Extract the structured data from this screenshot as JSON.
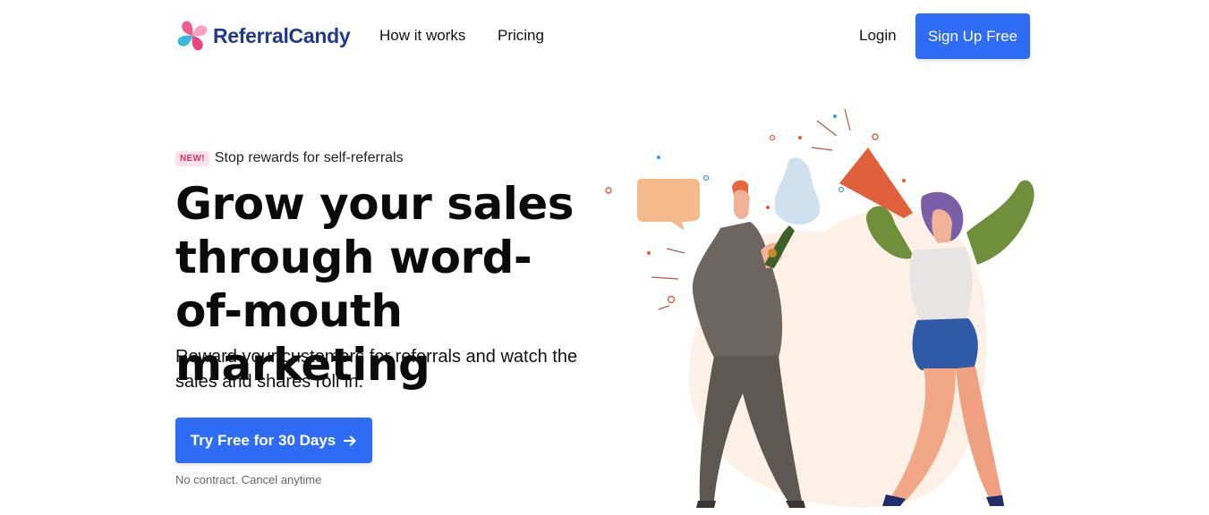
{
  "brand": {
    "name": "ReferralCandy"
  },
  "nav": {
    "links": [
      "How it works",
      "Pricing"
    ],
    "login": "Login",
    "signup": "Sign Up Free"
  },
  "hero": {
    "badge": "NEW!",
    "announcement": "Stop rewards for self-referrals",
    "headline": "Grow your sales through word-of-mouth marketing",
    "subheadline": "Reward your customers for referrals and watch the sales and shares roll in.",
    "cta": "Try Free for 30 Days",
    "fine_print": "No contract. Cancel anytime"
  },
  "colors": {
    "primary": "#2f6cf6",
    "brand_text": "#1f3a8a",
    "badge_bg": "#fde2ec",
    "badge_text": "#d6336c"
  },
  "icons": [
    "logo-swirl-icon",
    "arrow-right-icon"
  ],
  "illustration": "two-people-celebrating-illustration"
}
